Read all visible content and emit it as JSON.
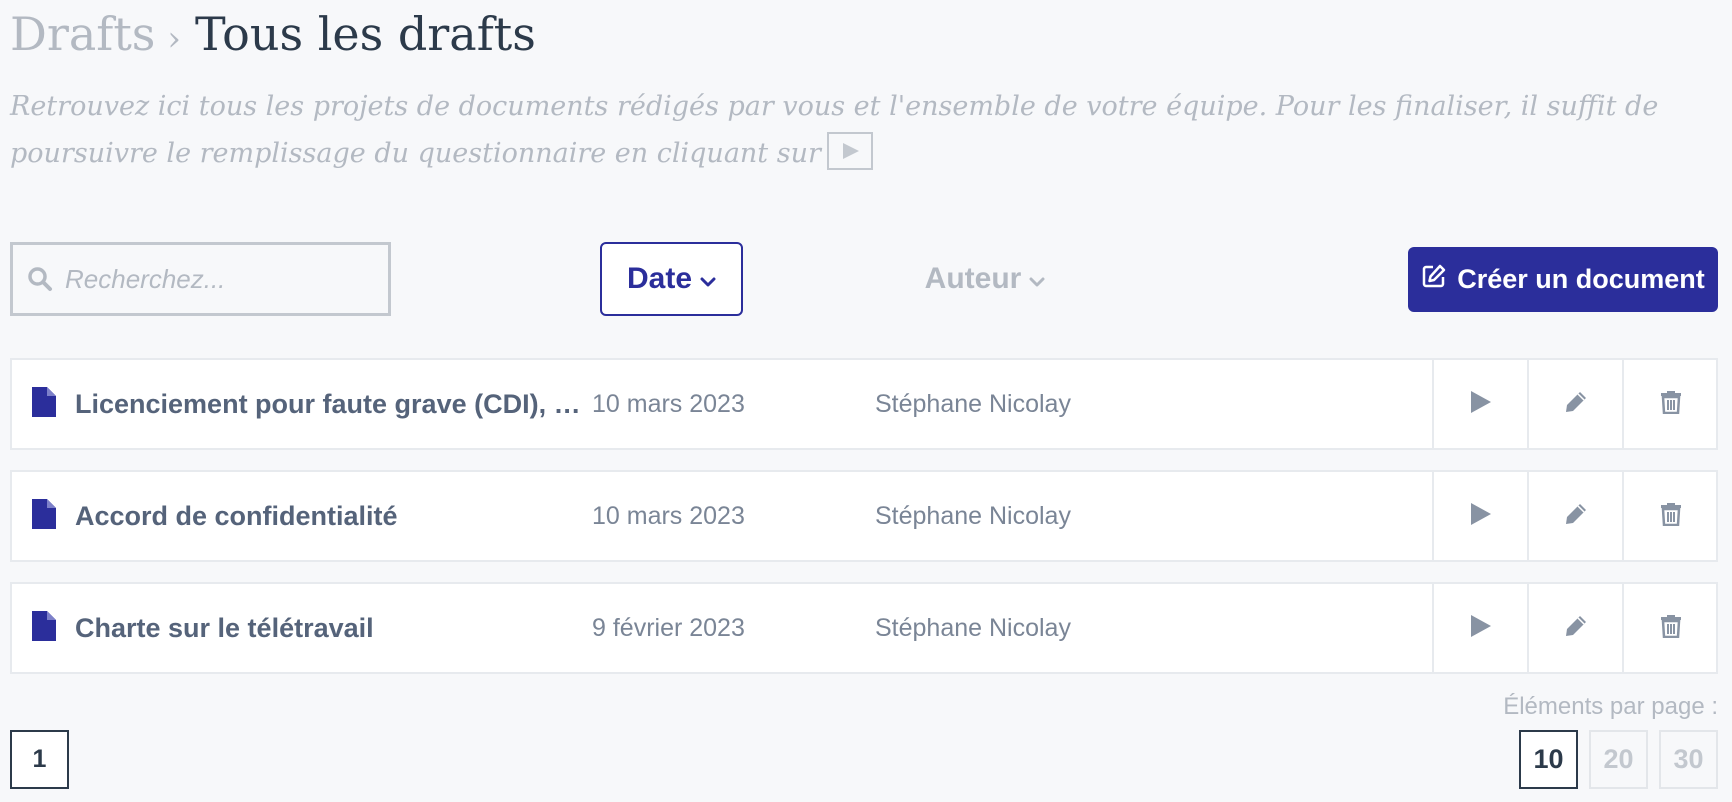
{
  "breadcrumb": {
    "root": "Drafts",
    "separator": "›",
    "current": "Tous les drafts"
  },
  "intro": {
    "text": "Retrouvez ici tous les projets de documents rédigés par vous et l'ensemble de votre équipe. Pour les finaliser, il suffit de poursuivre le remplissage du questionnaire en cliquant sur"
  },
  "search": {
    "placeholder": "Recherchez..."
  },
  "filters": {
    "date_label": "Date",
    "author_label": "Auteur"
  },
  "create_button": {
    "label": "Créer un document"
  },
  "drafts": [
    {
      "title": "Licenciement pour faute grave (CDI), c’...",
      "date": "10 mars 2023",
      "author": "Stéphane Nicolay"
    },
    {
      "title": "Accord de confidentialité",
      "date": "10 mars 2023",
      "author": "Stéphane Nicolay"
    },
    {
      "title": "Charte sur le télétravail",
      "date": "9 février 2023",
      "author": "Stéphane Nicolay"
    }
  ],
  "pagination": {
    "current_page": "1"
  },
  "per_page": {
    "label": "Éléments par page :",
    "options": [
      "10",
      "20",
      "30"
    ],
    "selected": "10"
  },
  "colors": {
    "accent": "#2b2e9b",
    "muted_text": "#b3b9c2",
    "icon_gray": "#8893a3"
  }
}
